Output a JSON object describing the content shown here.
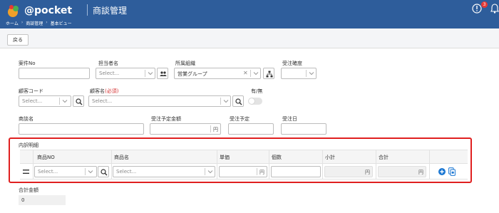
{
  "header": {
    "logo_text": "@pocket",
    "app_title": "商談管理",
    "breadcrumb": [
      "ホーム",
      "商談管理",
      "基本ビュー"
    ],
    "notification_count": "3"
  },
  "toolbar": {
    "back_label": "戻る"
  },
  "form": {
    "case_no": {
      "label": "案件No",
      "value": ""
    },
    "owner": {
      "label": "担当者名",
      "placeholder": "Select..."
    },
    "org": {
      "label": "所属組織",
      "value": "営業グループ"
    },
    "confidence": {
      "label": "受注確度",
      "value": ""
    },
    "customer_code": {
      "label": "顧客コード",
      "placeholder": "Select..."
    },
    "customer_name": {
      "label": "顧客名",
      "required": "(必須)",
      "placeholder": "Select..."
    },
    "active": {
      "label": "有/無"
    },
    "deal_name": {
      "label": "商談名",
      "value": ""
    },
    "expected_amount": {
      "label": "受注予定金額",
      "suffix": "円"
    },
    "expected_date": {
      "label": "受注予定"
    },
    "order_date": {
      "label": "受注日"
    }
  },
  "details": {
    "title": "内訳明細",
    "columns": [
      "商品NO",
      "商品名",
      "単価",
      "個数",
      "小計",
      "合計"
    ],
    "row": {
      "product_no_placeholder": "Select...",
      "product_name_placeholder": "Select...",
      "unit_price_suffix": "円",
      "subtotal_suffix": "円",
      "total_suffix": "円"
    }
  },
  "total": {
    "label": "合計金額",
    "value": "0"
  },
  "colors": {
    "header_bg": "#2e5d9b",
    "highlight": "#e02020",
    "accent": "#1976d2"
  }
}
